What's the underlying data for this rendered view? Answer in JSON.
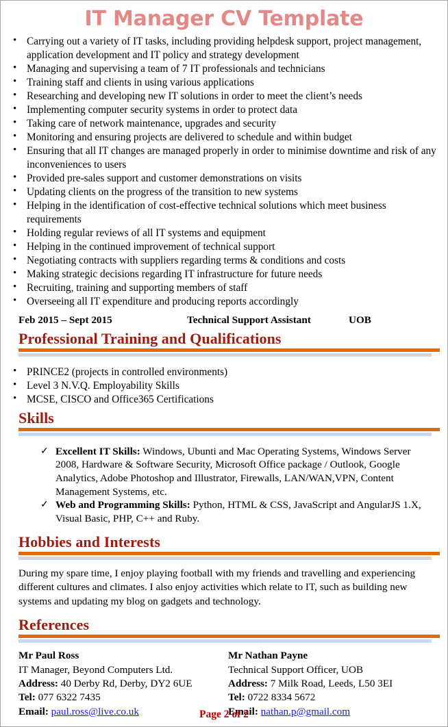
{
  "document": {
    "title": "IT Manager CV Template",
    "footer": "Page 2 of 2"
  },
  "duties": {
    "items": [
      "Carrying out a variety of IT tasks, including providing helpdesk support, project management, application development and IT policy and strategy development",
      "Managing and supervising a team of 7 IT professionals and technicians",
      "Training staff and clients in using various applications",
      "Researching and developing new IT solutions in order to meet the client’s needs",
      "Implementing computer security systems in order to protect data",
      "Taking care of network maintenance, upgrades and security",
      "Monitoring and ensuring projects are delivered to schedule and within budget",
      "Ensuring that all IT changes are managed properly in order to minimise downtime and risk of any inconveniences to users",
      "Provided pre-sales support and customer demonstrations on visits",
      "Updating clients on the progress of the transition to new systems",
      "Helping in the identification of cost-effective technical solutions which meet business requirements",
      "Holding regular reviews of all IT systems and equipment",
      "Helping in the continued improvement of technical support",
      "Negotiating contracts with suppliers regarding terms & conditions and costs",
      "Making strategic decisions regarding IT infrastructure for future needs",
      "Recruiting, training and supporting members of staff",
      "Overseeing all IT expenditure and producing reports accordingly"
    ]
  },
  "job": {
    "dates": "Feb 2015 – Sept 2015",
    "title": "Technical Support Assistant",
    "organisation": "UOB"
  },
  "sections": {
    "training": {
      "heading": "Professional Training and Qualifications",
      "items": [
        "PRINCE2 (projects in controlled environments)",
        "Level 3 N.V.Q. Employability Skills",
        "MCSE, CISCO and Office365 Certifications"
      ]
    },
    "skills": {
      "heading": "Skills",
      "items": [
        {
          "lead": "Excellent IT Skills:",
          "body": " Windows, Ubunti and Mac Operating Systems, Windows Server 2008, Hardware & Software Security, Microsoft Office package / Outlook, Google Analytics, Adobe Photoshop and Illustrator, Firewalls, LAN/WAN,VPN, Content Management Systems, etc."
        },
        {
          "lead": "Web and Programming Skills:",
          "body": " Python, HTML & CSS, JavaScript and AngularJS 1.X, Visual Basic, PHP, C++ and Ruby."
        }
      ]
    },
    "hobbies": {
      "heading": "Hobbies and Interests",
      "paragraph": "During my spare time, I enjoy playing football with my friends and travelling and experiencing different cultures and climates. I also enjoy activities which relate to IT, such as building new systems and updating my blog on gadgets and technology."
    },
    "references": {
      "heading": "References",
      "labels": {
        "address": "Address:",
        "tel": "Tel:",
        "email": "Email:"
      },
      "entries": [
        {
          "name": "Mr Paul Ross",
          "role": "IT Manager, Beyond Computers Ltd.",
          "address": " 40 Derby Rd, Derby, DY2 6UE",
          "tel": " 077 6322 7435",
          "email": "paul.ross@live.co.uk"
        },
        {
          "name": "Mr Nathan Payne",
          "role": "Technical Support Officer, UOB",
          "address": " 7 Milk Road, Leeds, L50 3EI",
          "tel": " 0722 8334 5672",
          "email": "nathan.p@gmail.com"
        }
      ]
    }
  },
  "colors": {
    "title": "#e48787",
    "heading": "#9e1b10",
    "rule_orange": "#e2690c",
    "rule_blue": "#c9d8ef",
    "link": "#1a1aee",
    "footer": "#c00000"
  }
}
